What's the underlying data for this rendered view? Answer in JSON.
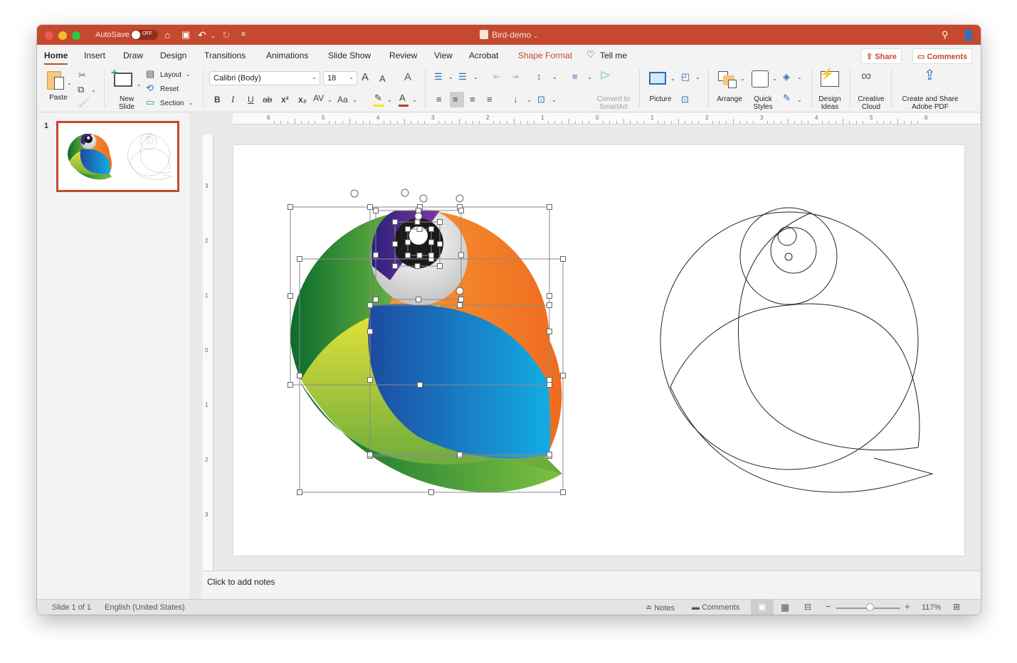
{
  "titlebar": {
    "autosave_label": "AutoSave",
    "autosave_state": "OFF",
    "doc_title": "Bird-demo",
    "icons": [
      "home-icon",
      "save-icon",
      "undo-icon",
      "redo-icon",
      "customize-toolbar-icon",
      "search-icon",
      "share-person-icon"
    ]
  },
  "tabs": [
    {
      "label": "Home",
      "active": true
    },
    {
      "label": "Insert"
    },
    {
      "label": "Draw"
    },
    {
      "label": "Design"
    },
    {
      "label": "Transitions"
    },
    {
      "label": "Animations"
    },
    {
      "label": "Slide Show"
    },
    {
      "label": "Review"
    },
    {
      "label": "View"
    },
    {
      "label": "Acrobat"
    },
    {
      "label": "Shape Format",
      "contextual": true
    },
    {
      "label": "Tell me"
    }
  ],
  "header_buttons": {
    "share": "Share",
    "comments": "Comments"
  },
  "ribbon": {
    "paste": "Paste",
    "new_slide_1": "New",
    "new_slide_2": "Slide",
    "layout": "Layout",
    "reset": "Reset",
    "section": "Section",
    "font_name": "Calibri (Body)",
    "font_size": "18",
    "bold": "B",
    "italic": "I",
    "underline": "U",
    "strike": "ab",
    "superscript": "x²",
    "subscript": "x₂",
    "spacing": "AV",
    "change_case": "Aa",
    "grow_font": "A",
    "shrink_font": "A",
    "convert_smartart_1": "Convert to",
    "convert_smartart_2": "SmartArt",
    "picture": "Picture",
    "arrange": "Arrange",
    "quick_styles_1": "Quick",
    "quick_styles_2": "Styles",
    "design_ideas_1": "Design",
    "design_ideas_2": "Ideas",
    "creative_cloud_1": "Creative",
    "creative_cloud_2": "Cloud",
    "adobe_pdf_1": "Create and Share",
    "adobe_pdf_2": "Adobe PDF",
    "colors": {
      "highlight": "#f5e400",
      "font_color": "#c0392b"
    }
  },
  "thumbnails": [
    {
      "number": "1",
      "selected": true
    }
  ],
  "hruler_labels": [
    "6",
    "5",
    "4",
    "3",
    "2",
    "1",
    "0",
    "1",
    "2",
    "3",
    "4",
    "5",
    "6"
  ],
  "vruler_labels": [
    "3",
    "2",
    "1",
    "0",
    "1",
    "2",
    "3"
  ],
  "notes": {
    "placeholder": "Click to add notes"
  },
  "status": {
    "slide_info": "Slide 1 of 1",
    "language": "English (United States)",
    "notes": "Notes",
    "comments": "Comments",
    "zoom": "117%",
    "zoom_fraction": 0.52
  },
  "brand": {
    "accent": "#c4492e"
  }
}
